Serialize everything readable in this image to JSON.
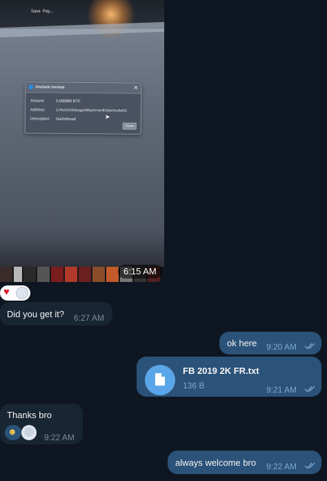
{
  "photo_message": {
    "time": "6:15 AM",
    "screen_top_labels": [
      "Save",
      "Pay..."
    ],
    "dialog": {
      "title": "Onchain Invoice",
      "amount_label": "Amount:",
      "amount_value": "0.000086 BTC",
      "address_label": "Address:",
      "address_value": "1J7kcDK2N3sugpD8tkyGmamfDQwDmu6e5G",
      "description_label": "Description:",
      "description_value": "GarlicBread",
      "close_button": "Close"
    }
  },
  "photo_reactions": [
    "red-heart",
    "sticker-face"
  ],
  "messages": [
    {
      "direction": "incoming",
      "text": "Did you get it?",
      "time": "6:27 AM"
    },
    {
      "direction": "outgoing",
      "text": "ok here",
      "time": "9:20 AM",
      "status": "read"
    },
    {
      "direction": "outgoing",
      "type": "file",
      "file_name": "FB 2019 2K FR.txt",
      "file_size": "136 B",
      "time": "9:21 AM",
      "status": "read"
    },
    {
      "direction": "incoming",
      "text": "Thanks bro",
      "time": "9:22 AM",
      "reactions": [
        "heart-eyes-emoji",
        "sticker-face"
      ]
    },
    {
      "direction": "outgoing",
      "text": "always welcome bro",
      "time": "9:22 AM",
      "status": "read"
    }
  ],
  "colors": {
    "background": "#0e1621",
    "incoming_bubble": "#182533",
    "outgoing_bubble": "#2b5278",
    "incoming_time": "#7c8b98",
    "outgoing_time": "#7da8d3",
    "file_icon": "#5aa6e8"
  }
}
